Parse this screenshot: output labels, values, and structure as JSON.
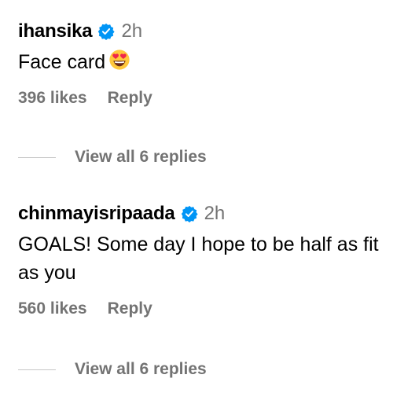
{
  "comments": [
    {
      "username": "ihansika",
      "verified": true,
      "time": "2h",
      "text": "Face card",
      "emoji": "smiling-face-with-heart-eyes",
      "likes": "396 likes",
      "reply_label": "Reply",
      "view_replies": "View all 6 replies"
    },
    {
      "username": "chinmayisripaada",
      "verified": true,
      "time": "2h",
      "text": "GOALS! Some day I hope to be half as fit as you",
      "likes": "560 likes",
      "reply_label": "Reply",
      "view_replies": "View all 6 replies"
    }
  ],
  "colors": {
    "verified_badge": "#0095f6",
    "secondary_text": "#737373",
    "divider": "#c7c7c7"
  }
}
